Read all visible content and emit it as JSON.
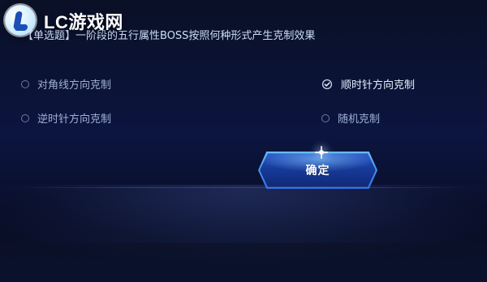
{
  "watermark": {
    "text": "LC游戏网",
    "icon": "lc-logo-icon"
  },
  "question": {
    "text": "【单选题】一阶段的五行属性BOSS按照何种形式产生克制效果"
  },
  "options": [
    {
      "label": "对角线方向克制",
      "selected": false
    },
    {
      "label": "顺时针方向克制",
      "selected": true
    },
    {
      "label": "逆时针方向克制",
      "selected": false
    },
    {
      "label": "随机克制",
      "selected": false
    }
  ],
  "actions": {
    "confirm_label": "确定"
  },
  "colors": {
    "accent": "#6ec5ff",
    "button_fill": "#173a9a"
  }
}
